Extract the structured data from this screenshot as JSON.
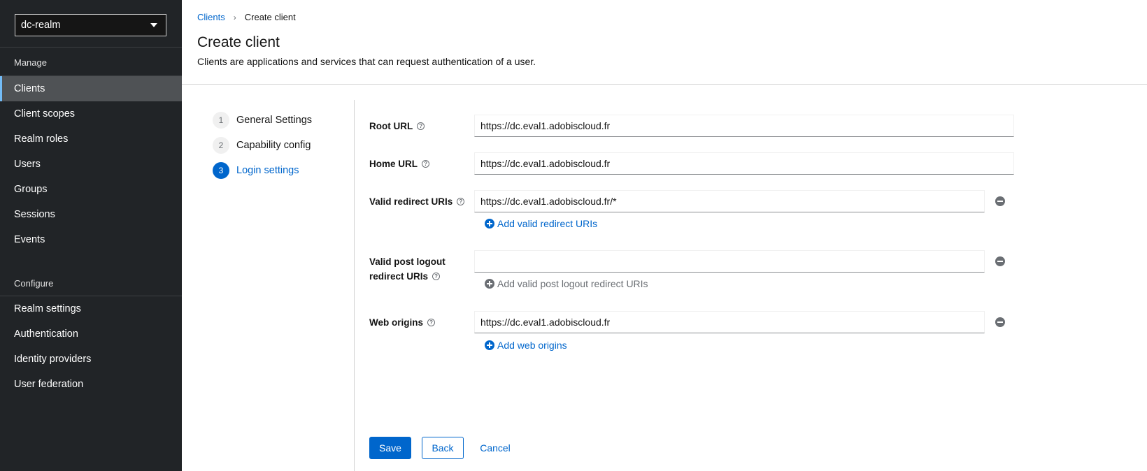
{
  "sidebar": {
    "realm": "dc-realm",
    "manage_title": "Manage",
    "manage_items": [
      {
        "label": "Clients",
        "active": true
      },
      {
        "label": "Client scopes"
      },
      {
        "label": "Realm roles"
      },
      {
        "label": "Users"
      },
      {
        "label": "Groups"
      },
      {
        "label": "Sessions"
      },
      {
        "label": "Events"
      }
    ],
    "configure_title": "Configure",
    "configure_items": [
      {
        "label": "Realm settings"
      },
      {
        "label": "Authentication"
      },
      {
        "label": "Identity providers"
      },
      {
        "label": "User federation"
      }
    ]
  },
  "breadcrumb": {
    "parent": "Clients",
    "current": "Create client"
  },
  "header": {
    "title": "Create client",
    "description": "Clients are applications and services that can request authentication of a user."
  },
  "wizard": {
    "steps": [
      {
        "num": "1",
        "label": "General Settings"
      },
      {
        "num": "2",
        "label": "Capability config"
      },
      {
        "num": "3",
        "label": "Login settings",
        "current": true
      }
    ]
  },
  "form": {
    "root_url": {
      "label": "Root URL",
      "value": "https://dc.eval1.adobiscloud.fr"
    },
    "home_url": {
      "label": "Home URL",
      "value": "https://dc.eval1.adobiscloud.fr"
    },
    "valid_redirect": {
      "label": "Valid redirect URIs",
      "value": "https://dc.eval1.adobiscloud.fr/*",
      "add_label": "Add valid redirect URIs"
    },
    "post_logout": {
      "label_line1": "Valid post logout",
      "label_line2": "redirect URIs",
      "value": "",
      "add_label": "Add valid post logout redirect URIs"
    },
    "web_origins": {
      "label": "Web origins",
      "value": "https://dc.eval1.adobiscloud.fr",
      "add_label": "Add web origins"
    }
  },
  "actions": {
    "save": "Save",
    "back": "Back",
    "cancel": "Cancel"
  },
  "colors": {
    "sidebar_bg": "#212427",
    "active_nav": "#4f5255",
    "accent": "#0066cc"
  }
}
